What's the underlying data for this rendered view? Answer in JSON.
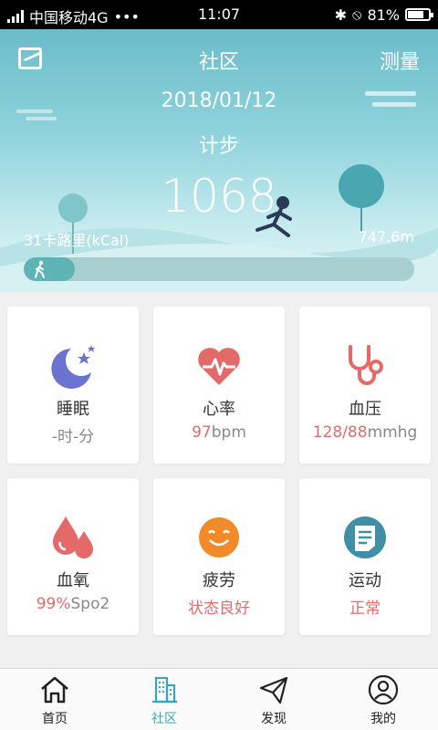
{
  "status_bar": {
    "carrier": "中国移动4G",
    "dots": "•••",
    "time": "11:07",
    "battery": "81%",
    "battery_level": 0.81
  },
  "header": {
    "title": "社区",
    "right_action": "测量",
    "left_icon": "chart-card-icon"
  },
  "summary": {
    "date": "2018/01/12",
    "mode": "计步",
    "steps": "1068",
    "calories": "31卡路里(kCal)",
    "distance": "747.6m",
    "progress": 0.13,
    "progress_icon": "walking-icon"
  },
  "cards": [
    {
      "icon": "moon-stars-icon",
      "name": "睡眠",
      "value": "-时-分",
      "value_parts": [
        {
          "text": "-时-分",
          "red": false
        }
      ]
    },
    {
      "icon": "heart-pulse-icon",
      "name": "心率",
      "value_parts": [
        {
          "text": "97",
          "red": true
        },
        {
          "text": "bpm",
          "red": false
        }
      ]
    },
    {
      "icon": "stethoscope-icon",
      "name": "血压",
      "value_parts": [
        {
          "text": "128/88",
          "red": true
        },
        {
          "text": "mmhg",
          "red": false
        }
      ]
    },
    {
      "icon": "water-drops-icon",
      "name": "血氧",
      "value_parts": [
        {
          "text": "99%",
          "red": true
        },
        {
          "text": "Spo2",
          "red": false
        }
      ]
    },
    {
      "icon": "smiley-face-icon",
      "name": "疲劳",
      "value_parts": [
        {
          "text": "状态良好",
          "red": true
        }
      ]
    },
    {
      "icon": "document-list-icon",
      "name": "运动",
      "value_parts": [
        {
          "text": "正常",
          "red": true
        }
      ]
    }
  ],
  "tabs": [
    {
      "label": "首页",
      "icon": "home-icon",
      "active": false
    },
    {
      "label": "社区",
      "icon": "building-icon",
      "active": true
    },
    {
      "label": "发现",
      "icon": "paper-plane-icon",
      "active": false
    },
    {
      "label": "我的",
      "icon": "user-circle-icon",
      "active": false
    }
  ],
  "colors": {
    "accent": "#3aa5b6",
    "alert": "#e66a6a",
    "hero_top": "#6bbcc9"
  }
}
